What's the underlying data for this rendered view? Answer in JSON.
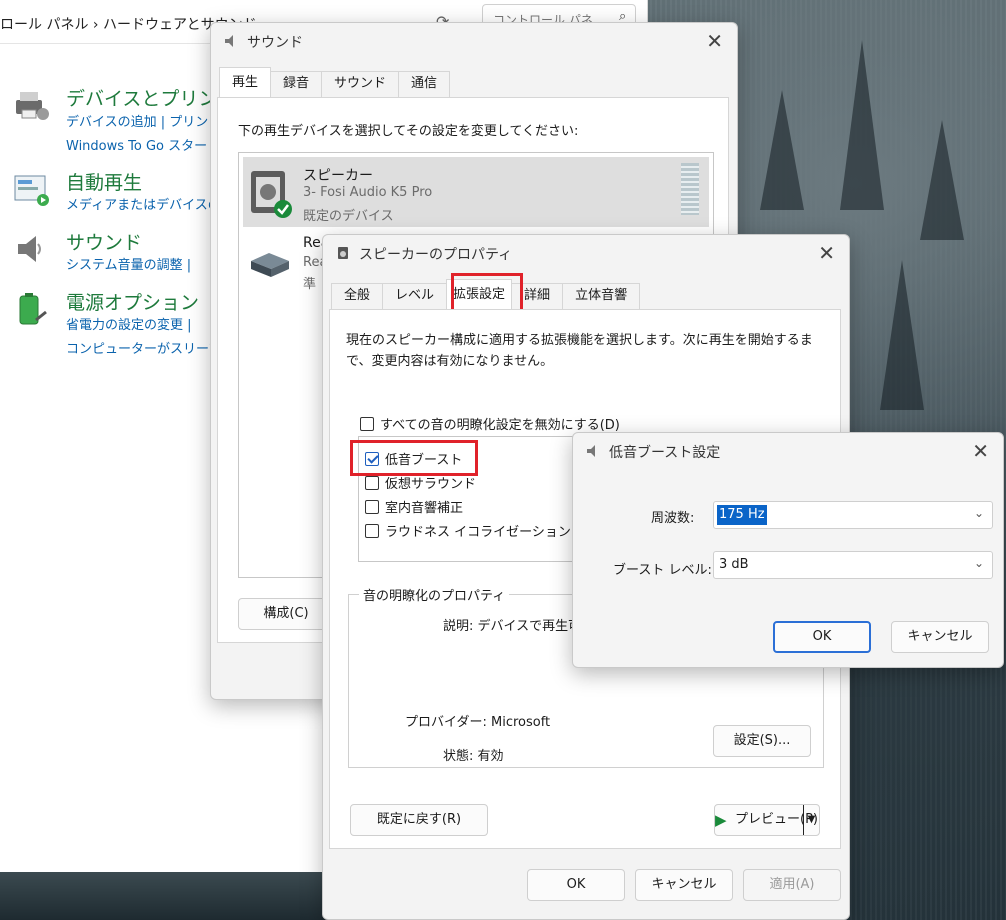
{
  "control_panel": {
    "breadcrumb": "ロール パネル  ›  ハードウェアとサウンド",
    "search_placeholder": "コントロール パネ",
    "categories": [
      {
        "title": "デバイスとプリンター",
        "links": [
          "デバイスの追加  |  プリン",
          "Windows To Go スター"
        ]
      },
      {
        "title": "自動再生",
        "links": [
          "メディアまたはデバイスの既"
        ]
      },
      {
        "title": "サウンド",
        "links": [
          "システム音量の調整  |"
        ]
      },
      {
        "title": "電源オプション",
        "links": [
          "省電力の設定の変更  |",
          "コンピューターがスリープ状"
        ]
      }
    ]
  },
  "sound_dialog": {
    "title": "サウンド",
    "tabs": [
      "再生",
      "録音",
      "サウンド",
      "通信"
    ],
    "instruction": "下の再生デバイスを選択してその設定を変更してください:",
    "devices": [
      {
        "name": "スピーカー",
        "detail": "3- Fosi Audio K5 Pro",
        "status": "既定のデバイス"
      },
      {
        "name": "Rea",
        "detail": "Rea",
        "status": "準"
      }
    ],
    "configure_button": "構成(C)"
  },
  "speaker_props": {
    "title": "スピーカーのプロパティ",
    "tabs": [
      "全般",
      "レベル",
      "拡張設定",
      "詳細",
      "立体音響"
    ],
    "description": "現在のスピーカー構成に適用する拡張機能を選択します。次に再生を開始するまで、変更内容は有効になりません。",
    "disable_all": "すべての音の明瞭化設定を無効にする(D)",
    "enhancements": [
      {
        "label": "低音ブースト",
        "checked": true
      },
      {
        "label": "仮想サラウンド",
        "checked": false
      },
      {
        "label": "室内音響補正",
        "checked": false
      },
      {
        "label": "ラウドネス イコライゼーション",
        "checked": false
      }
    ],
    "group_title": "音の明瞭化のプロパティ",
    "desc_label": "説明: デバイスで再生可",
    "provider": "プロバイダー: Microsoft",
    "state": "状態: 有効",
    "settings_button": "設定(S)...",
    "restore_button": "既定に戻す(R)",
    "preview_button": "プレビュー(P)",
    "ok": "OK",
    "cancel": "キャンセル",
    "apply": "適用(A)"
  },
  "bass_boost": {
    "title": "低音ブースト設定",
    "frequency_label": "周波数:",
    "frequency_value": "175 Hz",
    "boost_label": "ブースト レベル:",
    "boost_value": "3 dB",
    "ok": "OK",
    "cancel": "キャンセル"
  },
  "colors": {
    "accent": "#2b6fd6",
    "highlight": "#e0222a",
    "link": "#0b63ad",
    "category": "#1e7a3c"
  }
}
